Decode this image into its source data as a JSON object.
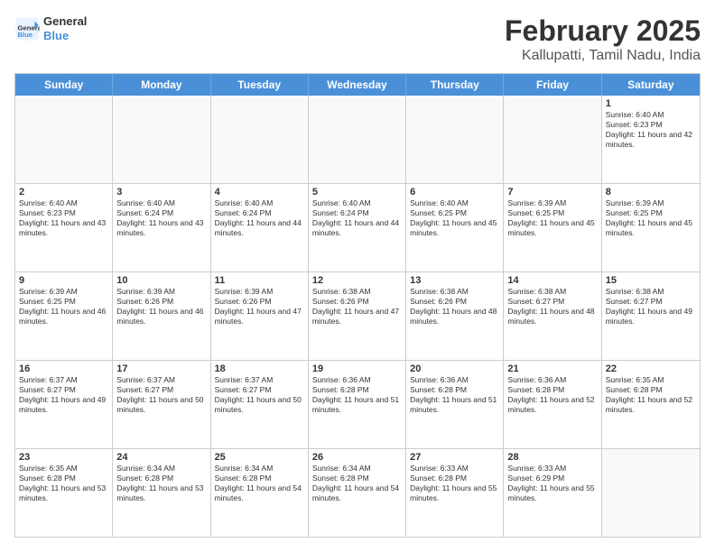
{
  "header": {
    "logo_general": "General",
    "logo_blue": "Blue",
    "title": "February 2025",
    "subtitle": "Kallupatti, Tamil Nadu, India"
  },
  "days_of_week": [
    "Sunday",
    "Monday",
    "Tuesday",
    "Wednesday",
    "Thursday",
    "Friday",
    "Saturday"
  ],
  "weeks": [
    [
      {
        "day": "",
        "text": ""
      },
      {
        "day": "",
        "text": ""
      },
      {
        "day": "",
        "text": ""
      },
      {
        "day": "",
        "text": ""
      },
      {
        "day": "",
        "text": ""
      },
      {
        "day": "",
        "text": ""
      },
      {
        "day": "1",
        "text": "Sunrise: 6:40 AM\nSunset: 6:23 PM\nDaylight: 11 hours and 42 minutes."
      }
    ],
    [
      {
        "day": "2",
        "text": "Sunrise: 6:40 AM\nSunset: 6:23 PM\nDaylight: 11 hours and 43 minutes."
      },
      {
        "day": "3",
        "text": "Sunrise: 6:40 AM\nSunset: 6:24 PM\nDaylight: 11 hours and 43 minutes."
      },
      {
        "day": "4",
        "text": "Sunrise: 6:40 AM\nSunset: 6:24 PM\nDaylight: 11 hours and 44 minutes."
      },
      {
        "day": "5",
        "text": "Sunrise: 6:40 AM\nSunset: 6:24 PM\nDaylight: 11 hours and 44 minutes."
      },
      {
        "day": "6",
        "text": "Sunrise: 6:40 AM\nSunset: 6:25 PM\nDaylight: 11 hours and 45 minutes."
      },
      {
        "day": "7",
        "text": "Sunrise: 6:39 AM\nSunset: 6:25 PM\nDaylight: 11 hours and 45 minutes."
      },
      {
        "day": "8",
        "text": "Sunrise: 6:39 AM\nSunset: 6:25 PM\nDaylight: 11 hours and 45 minutes."
      }
    ],
    [
      {
        "day": "9",
        "text": "Sunrise: 6:39 AM\nSunset: 6:25 PM\nDaylight: 11 hours and 46 minutes."
      },
      {
        "day": "10",
        "text": "Sunrise: 6:39 AM\nSunset: 6:26 PM\nDaylight: 11 hours and 46 minutes."
      },
      {
        "day": "11",
        "text": "Sunrise: 6:39 AM\nSunset: 6:26 PM\nDaylight: 11 hours and 47 minutes."
      },
      {
        "day": "12",
        "text": "Sunrise: 6:38 AM\nSunset: 6:26 PM\nDaylight: 11 hours and 47 minutes."
      },
      {
        "day": "13",
        "text": "Sunrise: 6:38 AM\nSunset: 6:26 PM\nDaylight: 11 hours and 48 minutes."
      },
      {
        "day": "14",
        "text": "Sunrise: 6:38 AM\nSunset: 6:27 PM\nDaylight: 11 hours and 48 minutes."
      },
      {
        "day": "15",
        "text": "Sunrise: 6:38 AM\nSunset: 6:27 PM\nDaylight: 11 hours and 49 minutes."
      }
    ],
    [
      {
        "day": "16",
        "text": "Sunrise: 6:37 AM\nSunset: 6:27 PM\nDaylight: 11 hours and 49 minutes."
      },
      {
        "day": "17",
        "text": "Sunrise: 6:37 AM\nSunset: 6:27 PM\nDaylight: 11 hours and 50 minutes."
      },
      {
        "day": "18",
        "text": "Sunrise: 6:37 AM\nSunset: 6:27 PM\nDaylight: 11 hours and 50 minutes."
      },
      {
        "day": "19",
        "text": "Sunrise: 6:36 AM\nSunset: 6:28 PM\nDaylight: 11 hours and 51 minutes."
      },
      {
        "day": "20",
        "text": "Sunrise: 6:36 AM\nSunset: 6:28 PM\nDaylight: 11 hours and 51 minutes."
      },
      {
        "day": "21",
        "text": "Sunrise: 6:36 AM\nSunset: 6:28 PM\nDaylight: 11 hours and 52 minutes."
      },
      {
        "day": "22",
        "text": "Sunrise: 6:35 AM\nSunset: 6:28 PM\nDaylight: 11 hours and 52 minutes."
      }
    ],
    [
      {
        "day": "23",
        "text": "Sunrise: 6:35 AM\nSunset: 6:28 PM\nDaylight: 11 hours and 53 minutes."
      },
      {
        "day": "24",
        "text": "Sunrise: 6:34 AM\nSunset: 6:28 PM\nDaylight: 11 hours and 53 minutes."
      },
      {
        "day": "25",
        "text": "Sunrise: 6:34 AM\nSunset: 6:28 PM\nDaylight: 11 hours and 54 minutes."
      },
      {
        "day": "26",
        "text": "Sunrise: 6:34 AM\nSunset: 6:28 PM\nDaylight: 11 hours and 54 minutes."
      },
      {
        "day": "27",
        "text": "Sunrise: 6:33 AM\nSunset: 6:28 PM\nDaylight: 11 hours and 55 minutes."
      },
      {
        "day": "28",
        "text": "Sunrise: 6:33 AM\nSunset: 6:29 PM\nDaylight: 11 hours and 55 minutes."
      },
      {
        "day": "",
        "text": ""
      }
    ]
  ]
}
